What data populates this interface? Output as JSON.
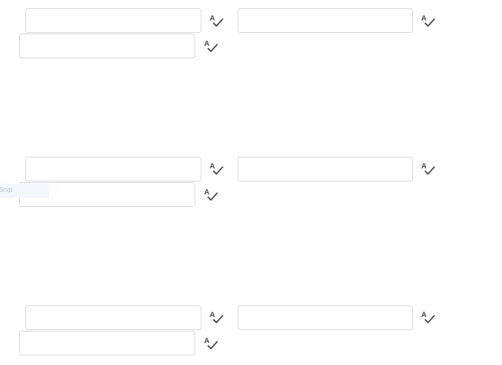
{
  "accent": "#4a4a4a",
  "field_border": "#d6d6db",
  "icon": "spell-check-icon",
  "ghost": {
    "label": "Snip"
  },
  "groups": [
    {
      "fields": [
        {
          "value": "",
          "placeholder": ""
        },
        {
          "value": "",
          "placeholder": ""
        },
        {
          "value": "",
          "placeholder": ""
        }
      ]
    },
    {
      "fields": [
        {
          "value": "",
          "placeholder": ""
        },
        {
          "value": "",
          "placeholder": ""
        },
        {
          "value": "",
          "placeholder": ""
        }
      ]
    },
    {
      "fields": [
        {
          "value": "",
          "placeholder": ""
        },
        {
          "value": "",
          "placeholder": ""
        },
        {
          "value": "",
          "placeholder": ""
        }
      ]
    }
  ]
}
